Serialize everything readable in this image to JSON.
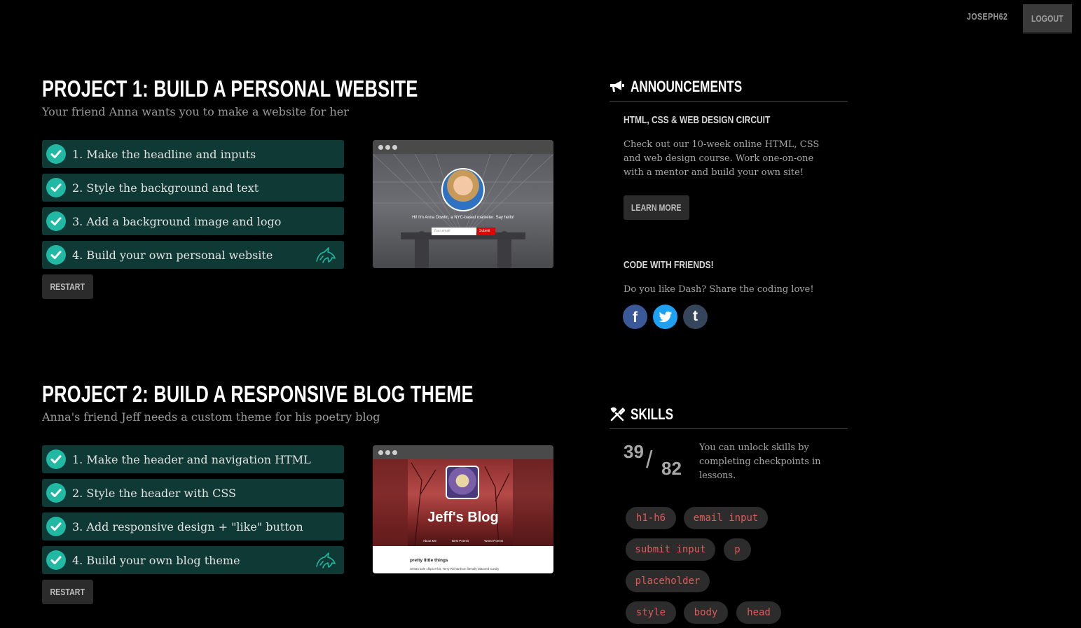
{
  "topbar": {
    "username": "JOSEPH62",
    "logout_label": "LOGOUT"
  },
  "projects": [
    {
      "title": "PROJECT 1: BUILD A PERSONAL WEBSITE",
      "subtitle": "Your friend Anna wants you to make a website for her",
      "steps": [
        {
          "label": "1. Make the headline and inputs",
          "completed": true
        },
        {
          "label": "2. Style the background and text",
          "completed": true
        },
        {
          "label": "3. Add a background image and logo",
          "completed": true
        },
        {
          "label": "4. Build your own personal website",
          "completed": true,
          "icon": "unicorn-icon"
        }
      ],
      "restart_label": "RESTART",
      "preview": {
        "tagline": "Hi! I'm Anna Dowlin, a NYC-based marketer. Say hello!",
        "email_placeholder": "Your email",
        "submit_label": "Submit"
      }
    },
    {
      "title": "PROJECT 2: BUILD A RESPONSIVE BLOG THEME",
      "subtitle": "Anna's friend Jeff needs a custom theme for his poetry blog",
      "steps": [
        {
          "label": "1. Make the header and navigation HTML",
          "completed": true
        },
        {
          "label": "2. Style the header with CSS",
          "completed": true
        },
        {
          "label": "3. Add responsive design + \"like\" button",
          "completed": true
        },
        {
          "label": "4. Build your own blog theme",
          "completed": true,
          "icon": "unicorn-icon"
        }
      ],
      "restart_label": "RESTART",
      "preview": {
        "blog_title": "Jeff's Blog",
        "nav": [
          "About Me",
          "Best Poems",
          "Worst Poems"
        ],
        "post_title": "pretty little things",
        "post_text": "Seitan kale chips 8-bit, Terry Richardson literally tattooed Cosby"
      }
    }
  ],
  "announcements": {
    "heading": "ANNOUNCEMENTS",
    "icon": "megaphone-icon",
    "circuit_title": "HTML, CSS & WEB DESIGN CIRCUIT",
    "circuit_text": "Check out our 10-week online HTML, CSS and web design course. Work one-on-one with a mentor and build your own site!",
    "learn_more_label": "LEARN MORE",
    "friends_title": "CODE WITH FRIENDS!",
    "friends_text": "Do you like Dash? Share the coding love!",
    "social": [
      {
        "name": "facebook",
        "glyph": "f",
        "color": "#3b5998"
      },
      {
        "name": "twitter",
        "color": "#1da1f2"
      },
      {
        "name": "tumblr",
        "glyph": "t",
        "color": "#35465c"
      }
    ]
  },
  "skills": {
    "heading": "SKILLS",
    "icon": "tools-icon",
    "unlocked": "39",
    "separator": "/",
    "total": "82",
    "description": "You can unlock skills by completing checkpoints in lessons.",
    "tags": [
      "h1-h6",
      "email input",
      "submit input",
      "p",
      "placeholder",
      "style",
      "body",
      "head"
    ]
  },
  "colors": {
    "background": "#000000",
    "step_bg": "#0f3934",
    "check": "#21b8a4",
    "skill_text": "#e05a5a"
  }
}
